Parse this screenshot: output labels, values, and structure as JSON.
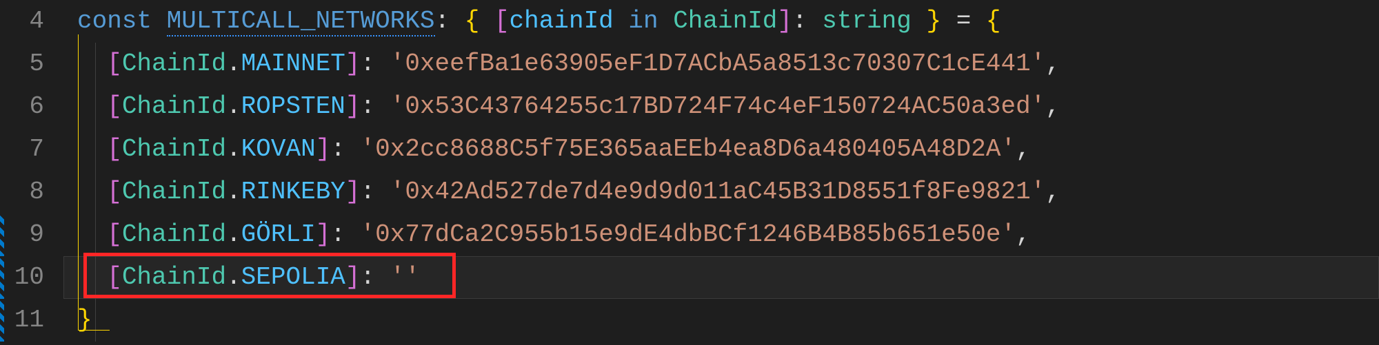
{
  "editor": {
    "lines": [
      {
        "num": "4",
        "indent": "",
        "tokens": [
          {
            "t": "const ",
            "cls": "kw"
          },
          {
            "t": "MULTICALL_NETWORKS",
            "cls": "const-nm squiggle"
          },
          {
            "t": ": ",
            "cls": "punc"
          },
          {
            "t": "{",
            "cls": "brace"
          },
          {
            "t": " ",
            "cls": "punc"
          },
          {
            "t": "[",
            "cls": "bracket"
          },
          {
            "t": "chainId ",
            "cls": "prop"
          },
          {
            "t": "in ",
            "cls": "in-kw"
          },
          {
            "t": "ChainId",
            "cls": "type"
          },
          {
            "t": "]",
            "cls": "bracket"
          },
          {
            "t": ": ",
            "cls": "punc"
          },
          {
            "t": "string",
            "cls": "type"
          },
          {
            "t": " ",
            "cls": "punc"
          },
          {
            "t": "}",
            "cls": "brace"
          },
          {
            "t": " = ",
            "cls": "punc"
          },
          {
            "t": "{",
            "cls": "brace"
          }
        ]
      },
      {
        "num": "5",
        "indent": "  ",
        "tokens": [
          {
            "t": "[",
            "cls": "bracket"
          },
          {
            "t": "ChainId",
            "cls": "enum"
          },
          {
            "t": ".",
            "cls": "punc"
          },
          {
            "t": "MAINNET",
            "cls": "prop"
          },
          {
            "t": "]",
            "cls": "bracket"
          },
          {
            "t": ": ",
            "cls": "punc"
          },
          {
            "t": "'0xeefBa1e63905eF1D7ACbA5a8513c70307C1cE441'",
            "cls": "str"
          },
          {
            "t": ",",
            "cls": "punc"
          }
        ]
      },
      {
        "num": "6",
        "indent": "  ",
        "tokens": [
          {
            "t": "[",
            "cls": "bracket"
          },
          {
            "t": "ChainId",
            "cls": "enum"
          },
          {
            "t": ".",
            "cls": "punc"
          },
          {
            "t": "ROPSTEN",
            "cls": "prop"
          },
          {
            "t": "]",
            "cls": "bracket"
          },
          {
            "t": ": ",
            "cls": "punc"
          },
          {
            "t": "'0x53C43764255c17BD724F74c4eF150724AC50a3ed'",
            "cls": "str"
          },
          {
            "t": ",",
            "cls": "punc"
          }
        ]
      },
      {
        "num": "7",
        "indent": "  ",
        "tokens": [
          {
            "t": "[",
            "cls": "bracket"
          },
          {
            "t": "ChainId",
            "cls": "enum"
          },
          {
            "t": ".",
            "cls": "punc"
          },
          {
            "t": "KOVAN",
            "cls": "prop"
          },
          {
            "t": "]",
            "cls": "bracket"
          },
          {
            "t": ": ",
            "cls": "punc"
          },
          {
            "t": "'0x2cc8688C5f75E365aaEEb4ea8D6a480405A48D2A'",
            "cls": "str"
          },
          {
            "t": ",",
            "cls": "punc"
          }
        ]
      },
      {
        "num": "8",
        "indent": "  ",
        "tokens": [
          {
            "t": "[",
            "cls": "bracket"
          },
          {
            "t": "ChainId",
            "cls": "enum"
          },
          {
            "t": ".",
            "cls": "punc"
          },
          {
            "t": "RINKEBY",
            "cls": "prop"
          },
          {
            "t": "]",
            "cls": "bracket"
          },
          {
            "t": ": ",
            "cls": "punc"
          },
          {
            "t": "'0x42Ad527de7d4e9d9d011aC45B31D8551f8Fe9821'",
            "cls": "str"
          },
          {
            "t": ",",
            "cls": "punc"
          }
        ]
      },
      {
        "num": "9",
        "indent": "  ",
        "tokens": [
          {
            "t": "[",
            "cls": "bracket"
          },
          {
            "t": "ChainId",
            "cls": "enum"
          },
          {
            "t": ".",
            "cls": "punc"
          },
          {
            "t": "GÖRLI",
            "cls": "prop"
          },
          {
            "t": "]",
            "cls": "bracket"
          },
          {
            "t": ": ",
            "cls": "punc"
          },
          {
            "t": "'0x77dCa2C955b15e9dE4dbBCf1246B4B85b651e50e'",
            "cls": "str"
          },
          {
            "t": ",",
            "cls": "punc"
          }
        ]
      },
      {
        "num": "10",
        "indent": "  ",
        "tokens": [
          {
            "t": "[",
            "cls": "bracket"
          },
          {
            "t": "ChainId",
            "cls": "enum"
          },
          {
            "t": ".",
            "cls": "punc"
          },
          {
            "t": "SEPOLIA",
            "cls": "prop"
          },
          {
            "t": "]",
            "cls": "bracket"
          },
          {
            "t": ": ",
            "cls": "punc"
          },
          {
            "t": "''",
            "cls": "str"
          }
        ],
        "active": true
      },
      {
        "num": "11",
        "indent": "",
        "tokens": [
          {
            "t": "}",
            "cls": "brace"
          }
        ]
      }
    ],
    "modified_lines": [
      "9",
      "10",
      "11"
    ]
  },
  "annotations": {
    "highlight_kind": "red-box",
    "highlighted_line_num": "10"
  },
  "colors": {
    "bg": "#1e1e1e",
    "active_bg": "#262626",
    "gutter_fg": "#858585",
    "keyword": "#569cd6",
    "type": "#4ec9b0",
    "property": "#4fc1ff",
    "string": "#ce9178",
    "brace": "#ffd602",
    "bracket": "#d570d5",
    "punct": "#d4d4d4",
    "squiggle": "#3794ff",
    "red_box": "#ff2626",
    "git_mod": "#007acc"
  }
}
